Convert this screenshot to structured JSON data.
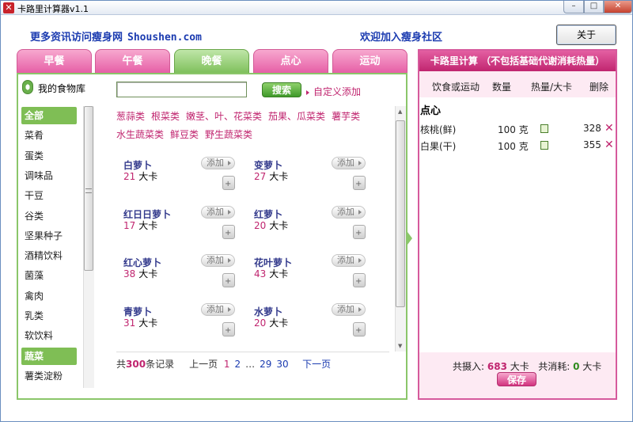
{
  "window": {
    "title": "卡路里计算器v1.1"
  },
  "header": {
    "promo_text": "更多资讯访问瘦身网",
    "site": "Shoushen.com",
    "welcome": "欢迎加入瘦身社区",
    "close_label": "关于"
  },
  "tabs": [
    "早餐",
    "午餐",
    "晚餐",
    "点心",
    "运动"
  ],
  "active_tab": "晚餐",
  "library": {
    "title": "我的食物库",
    "search_placeholder": "",
    "search_label": "搜索",
    "custom_add_label": "自定义添加"
  },
  "categories": [
    "全部",
    "菜肴",
    "蛋类",
    "调味品",
    "干豆",
    "谷类",
    "坚果种子",
    "酒精饮料",
    "菌藻",
    "禽肉",
    "乳类",
    "软饮料",
    "蔬菜",
    "薯类淀粉"
  ],
  "selected_categories": [
    "全部",
    "蔬菜"
  ],
  "subcategories": [
    "葱蒜类",
    "根菜类",
    "嫩茎、叶、花菜类",
    "茄果、瓜菜类",
    "薯芋类",
    "水生蔬菜类",
    "鲜豆类",
    "野生蔬菜类"
  ],
  "foods": [
    {
      "name": "白萝卜",
      "kcal": "21",
      "unit": "大卡",
      "add": "添加"
    },
    {
      "name": "变萝卜",
      "kcal": "27",
      "unit": "大卡",
      "add": "添加"
    },
    {
      "name": "红日日萝卜",
      "kcal": "17",
      "unit": "大卡",
      "add": "添加"
    },
    {
      "name": "红萝卜",
      "kcal": "20",
      "unit": "大卡",
      "add": "添加"
    },
    {
      "name": "红心萝卜",
      "kcal": "38",
      "unit": "大卡",
      "add": "添加"
    },
    {
      "name": "花叶萝卜",
      "kcal": "43",
      "unit": "大卡",
      "add": "添加"
    },
    {
      "name": "青萝卜",
      "kcal": "31",
      "unit": "大卡",
      "add": "添加"
    },
    {
      "name": "水萝卜",
      "kcal": "20",
      "unit": "大卡",
      "add": "添加"
    }
  ],
  "pager": {
    "prefix": "共",
    "total": "300",
    "suffix": "条记录",
    "prev": "上一页",
    "pages": [
      "1",
      "2",
      "…",
      "29",
      "30"
    ],
    "current": "1",
    "next": "下一页"
  },
  "calc": {
    "title": "卡路里计算 （不包括基础代谢消耗热量）",
    "col_item": "饮食或运动",
    "col_qty": "数量",
    "col_cal": "热量/大卡",
    "col_del": "删除",
    "section": "点心",
    "items": [
      {
        "name": "核桃(鲜)",
        "qty": "100 克",
        "cal": "328",
        "del": "✕"
      },
      {
        "name": "白果(干)",
        "qty": "100 克",
        "cal": "355",
        "del": "✕"
      }
    ],
    "intake_label": "共摄入:",
    "intake": "683",
    "intake_unit": "大卡",
    "burn_label": "共消耗:",
    "burn": "0",
    "burn_unit": "大卡",
    "save_label": "保存"
  },
  "colors": {
    "pink": "#c0256f",
    "green": "#7fbe55",
    "blue": "#1b3bb0"
  }
}
